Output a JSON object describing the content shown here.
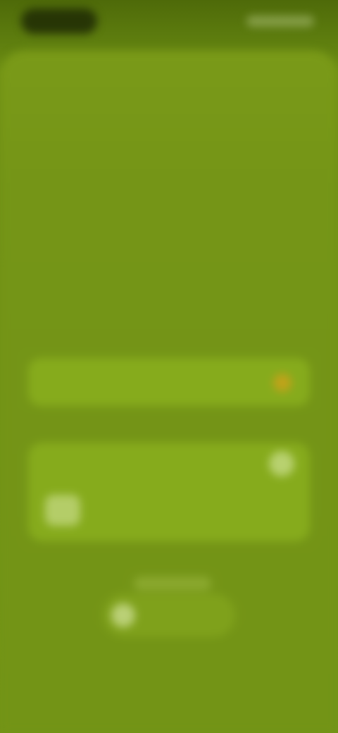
{
  "status_bar": {
    "time": "",
    "indicators": ""
  },
  "header": {
    "title": "",
    "subtitle": "",
    "subtitle_secondary": ""
  },
  "primary_row": {
    "label": "",
    "indicator_color": "#c0a31a"
  },
  "detail_card": {
    "label": "",
    "detail_text": ""
  },
  "bottom_action": {
    "label": ""
  },
  "colors": {
    "background": "#739416",
    "card": "#86ab1c",
    "status_pill": "#1f2a05",
    "accent_dot": "#c0a31a"
  },
  "icons": {
    "top_right_control": "circle-icon",
    "detail_icon": "image-icon",
    "bottom_action_icon": "circle-icon"
  }
}
